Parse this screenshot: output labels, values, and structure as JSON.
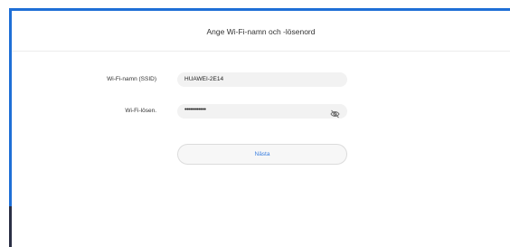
{
  "header": {
    "title": "Ange Wi-Fi-namn och -lösenord"
  },
  "form": {
    "ssid_label": "Wi-Fi-namn (SSID)",
    "ssid_value": "HUAWEI-2E14",
    "password_label": "Wi-Fi-lösen.",
    "password_value": "••••••••••••",
    "password_toggle_icon": "eye-hidden-icon"
  },
  "actions": {
    "next_label": "Nästa"
  },
  "colors": {
    "accent": "#3b7fe0",
    "frame": "#1f6fd6"
  }
}
